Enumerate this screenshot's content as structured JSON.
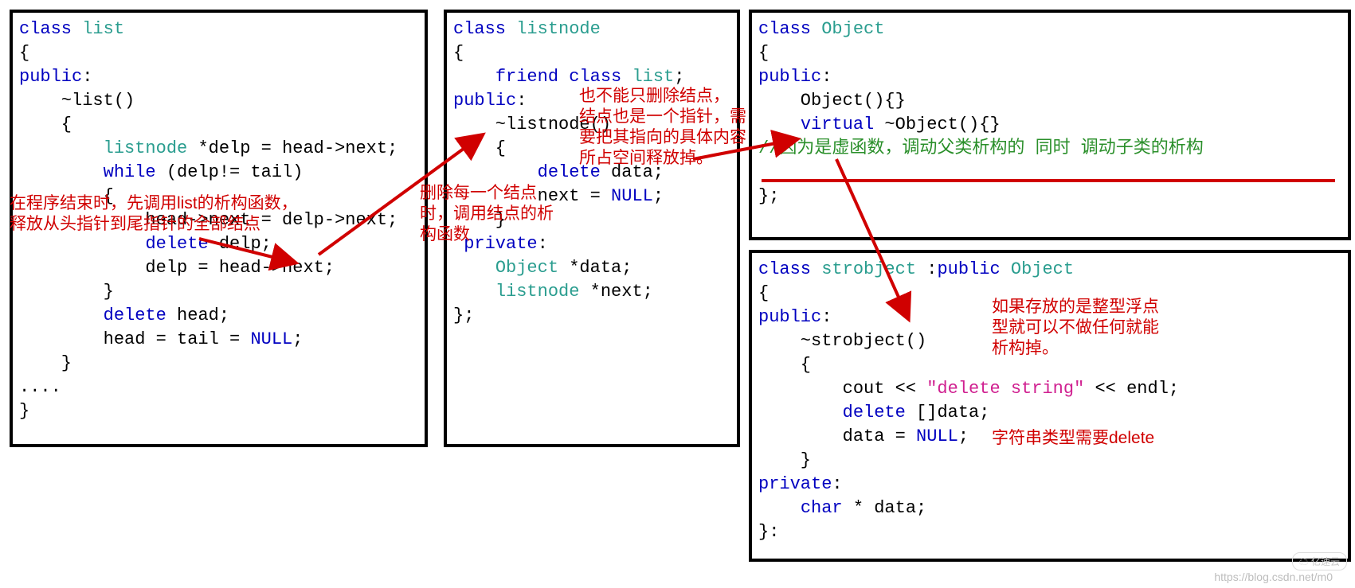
{
  "boxes": {
    "list": {
      "l1_class": "class",
      "l1_name": " list",
      "l2": "{",
      "l3_kw": "public",
      "l3_punc": ":",
      "l4_dtor": "    ~list()",
      "l5": "    {",
      "l6_pre": "        ",
      "l6_ty": "listnode",
      "l6_rest": " *delp = head->next;",
      "l7_pre": "        ",
      "l7_kw": "while",
      "l7_rest": " (delp!= tail)",
      "l8": "        {",
      "l9": "            head->next = delp->next;",
      "l10_pre": "            ",
      "l10_kw": "delete",
      "l10_rest": " delp;",
      "l11": "            delp = head->next;",
      "l12": "        }",
      "l13_pre": "        ",
      "l13_kw": "delete",
      "l13_rest": " head;",
      "l14_pre": "        head = tail = ",
      "l14_kw": "NULL",
      "l14_rest": ";",
      "l15": "    }",
      "l16": "....",
      "l17": "}"
    },
    "listnode": {
      "l1_class": "class",
      "l1_name": " listnode",
      "l2": "{",
      "l3_pre": "    ",
      "l3_kw": "friend class",
      "l3_ty": " list",
      "l3_rest": ";",
      "l4_kw": "public",
      "l4_punc": ":",
      "l5": "    ~listnode()",
      "l6": "    {",
      "l7_pre": "        ",
      "l7_kw": "delete",
      "l7_rest": " data;",
      "l8_pre": "        next = ",
      "l8_kw": "NULL",
      "l8_rest": ";",
      "l9": "    }",
      "l10_kw": " private",
      "l10_punc": ":",
      "l11_pre": "    ",
      "l11_ty": "Object",
      "l11_rest": " *data;",
      "l12_pre": "    ",
      "l12_ty": "listnode",
      "l12_rest": " *next;",
      "l13": "};"
    },
    "object": {
      "l1_class": "class",
      "l1_name": " Object",
      "l2": "{",
      "l3_kw": "public",
      "l3_punc": ":",
      "l4": "    Object(){}",
      "l5_pre": "    ",
      "l5_kw": "virtual",
      "l5_rest": " ~Object(){}",
      "l6_cm": "//因为是虚函数，调动父类析构的 同时 调动子类的析构",
      "l7": "};"
    },
    "strobject": {
      "l1_class": "class",
      "l1_name": " strobject",
      "l1_col": " :",
      "l1_pub": "public",
      "l1_ty": " Object",
      "l2": "{",
      "l3_kw": "public",
      "l3_punc": ":",
      "l4": "    ~strobject()",
      "l5": "    {",
      "l6_pre": "        cout << ",
      "l6_str": "\"delete string\"",
      "l6_rest": " << endl;",
      "l7_pre": "        ",
      "l7_kw": "delete",
      "l7_rest": " []data;",
      "l8_pre": "        data = ",
      "l8_kw": "NULL",
      "l8_rest": ";",
      "l9": "    }",
      "l10_kw": "private",
      "l10_punc": ":",
      "l11_pre": "    ",
      "l11_kw": "char",
      "l11_rest": " * data;",
      "l12": "}:"
    }
  },
  "annotations": {
    "a1": "在程序结束时，先调用list的析构函数，\n释放从头指针到尾指针的全部结点",
    "a2": "删除每一个结点\n时，调用结点的析\n构函数",
    "a3": "也不能只删除结点，\n结点也是一个指针，需\n要把其指向的具体内容\n所占空间释放掉。",
    "a4": "如果存放的是整型浮点\n型就可以不做任何就能\n析构掉。",
    "a5": "字符串类型需要delete"
  },
  "watermark": "https://blog.csdn.net/m0",
  "logo_text": "亿速云"
}
